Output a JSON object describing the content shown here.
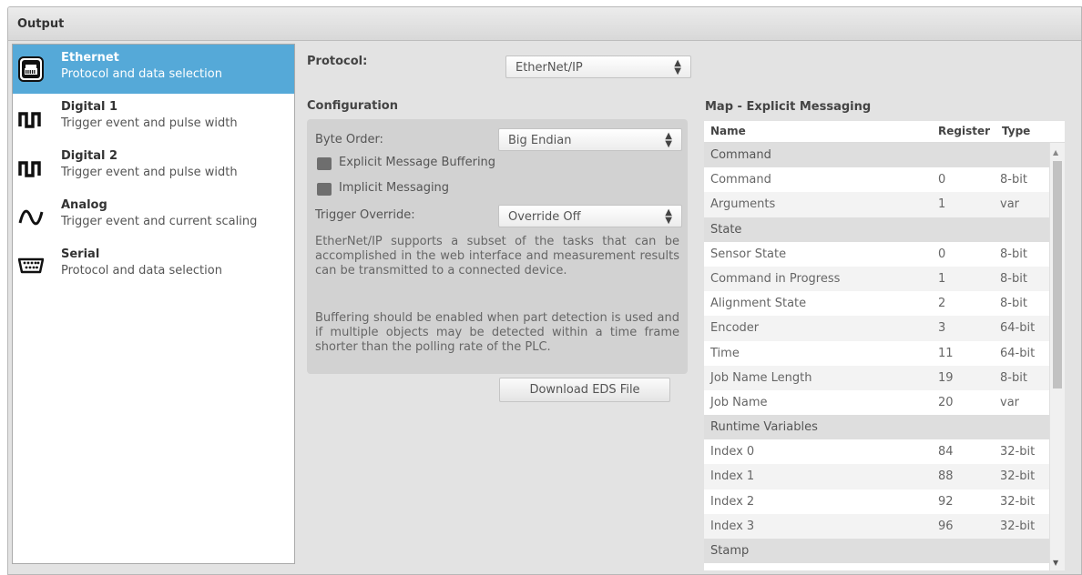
{
  "window": {
    "title": "Output"
  },
  "sidebar": {
    "items": [
      {
        "title": "Ethernet",
        "subtitle": "Protocol and data selection",
        "icon": "ethernet-port-icon",
        "active": true
      },
      {
        "title": "Digital 1",
        "subtitle": "Trigger event and pulse width",
        "icon": "pulse-wave-icon",
        "active": false
      },
      {
        "title": "Digital 2",
        "subtitle": "Trigger event and pulse width",
        "icon": "pulse-wave-icon",
        "active": false
      },
      {
        "title": "Analog",
        "subtitle": "Trigger event and current scaling",
        "icon": "sine-wave-icon",
        "active": false
      },
      {
        "title": "Serial",
        "subtitle": "Protocol and data selection",
        "icon": "serial-port-icon",
        "active": false
      }
    ]
  },
  "protocol": {
    "label": "Protocol:",
    "value": "EtherNet/IP"
  },
  "configuration": {
    "title": "Configuration",
    "byte_order_label": "Byte Order:",
    "byte_order_value": "Big Endian",
    "explicit_buffering_label": "Explicit Message Buffering",
    "implicit_messaging_label": "Implicit Messaging",
    "trigger_override_label": "Trigger Override:",
    "trigger_override_value": "Override Off",
    "description_1": "EtherNet/IP supports a subset of the tasks that can be accomplished in the web interface and measurement results can be transmitted to a connected device.",
    "description_2": "Buffering should be enabled when part detection is used and if multiple objects may be detected within a time frame shorter than the polling rate of the PLC.",
    "download_button": "Download EDS File"
  },
  "map": {
    "title": "Map - Explicit Messaging",
    "columns": [
      "Name",
      "Register",
      "Type"
    ],
    "rows": [
      {
        "group": "Command"
      },
      {
        "name": "Command",
        "register": "0",
        "type": "8-bit"
      },
      {
        "name": "Arguments",
        "register": "1",
        "type": "var"
      },
      {
        "group": "State"
      },
      {
        "name": "Sensor State",
        "register": "0",
        "type": "8-bit"
      },
      {
        "name": "Command in Progress",
        "register": "1",
        "type": "8-bit"
      },
      {
        "name": "Alignment State",
        "register": "2",
        "type": "8-bit"
      },
      {
        "name": "Encoder",
        "register": "3",
        "type": "64-bit"
      },
      {
        "name": "Time",
        "register": "11",
        "type": "64-bit"
      },
      {
        "name": "Job Name Length",
        "register": "19",
        "type": "8-bit"
      },
      {
        "name": "Job Name",
        "register": "20",
        "type": "var"
      },
      {
        "group": "Runtime Variables"
      },
      {
        "name": "Index 0",
        "register": "84",
        "type": "32-bit"
      },
      {
        "name": "Index 1",
        "register": "88",
        "type": "32-bit"
      },
      {
        "name": "Index 2",
        "register": "92",
        "type": "32-bit"
      },
      {
        "name": "Index 3",
        "register": "96",
        "type": "32-bit"
      },
      {
        "group": "Stamp"
      }
    ]
  },
  "colors": {
    "active": "#55a9d8",
    "panel": "#e3e3e3",
    "config_box": "#d2d2d2"
  }
}
